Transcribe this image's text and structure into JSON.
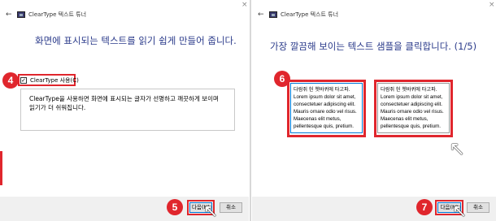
{
  "left": {
    "title": "ClearType 텍스트 튜너",
    "close": "×",
    "back": "←",
    "heading": "화면에 표시되는 텍스트를 읽기 쉽게 만들어 줍니다.",
    "checkbox_label": "ClearType 사용(C)",
    "checkbox_mark": "✓",
    "description": "ClearType을 사용하면 화면에 표시되는 글자가 선명하고 깨끗하게 보이며 읽기가 더 쉬워집니다.",
    "next_label": "다음(N)",
    "cancel_label": "취소",
    "badge_checkbox": "4",
    "badge_next": "5"
  },
  "right": {
    "title": "ClearType 텍스트 튜너",
    "close": "×",
    "back": "←",
    "heading": "가장 깔끔해 보이는 텍스트 샘플을 클릭합니다. (1/5)",
    "sample_1": {
      "korean": "다람쥐 헌 쳇바퀴에 타고파.",
      "latin": "Lorem ipsum dolor sit amet, consectetuer adipiscing elit. Mauris ornare odio vel risus. Maecenas elit metus, pellentesque quis, pretium."
    },
    "sample_2": {
      "korean": "다람쥐 헌 쳇바퀴에 타고파.",
      "latin": "Lorem ipsum dolor sit amet, consectetuer adipiscing elit. Mauris ornare odio vel risus. Maecenas elit metus, pellentesque quis, pretium."
    },
    "next_label": "다음(N)",
    "cancel_label": "취소",
    "badge_samples": "6",
    "badge_next": "7"
  },
  "cursor_glyph": "↖",
  "colors": {
    "heading": "#2a3a8a",
    "highlight": "#e0262d",
    "footer_bg": "#f0f0f0"
  }
}
